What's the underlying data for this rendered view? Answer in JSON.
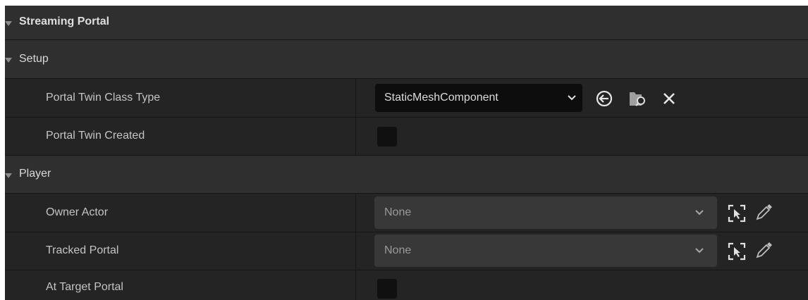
{
  "panel": {
    "title": "Streaming Portal"
  },
  "setup": {
    "label": "Setup",
    "properties": {
      "portal_twin_class_type": {
        "label": "Portal Twin Class Type",
        "value": "StaticMeshComponent"
      },
      "portal_twin_created": {
        "label": "Portal Twin Created",
        "checked": false
      }
    }
  },
  "player": {
    "label": "Player",
    "properties": {
      "owner_actor": {
        "label": "Owner Actor",
        "value": "None"
      },
      "tracked_portal": {
        "label": "Tracked Portal",
        "value": "None"
      },
      "at_target_portal": {
        "label": "At Target Portal",
        "checked": false
      }
    }
  },
  "icons": {
    "expand": "triangle-down-icon",
    "dropdown": "chevron-down-icon",
    "use_selected": "use-selected-arrow-icon",
    "browse": "browse-folder-icon",
    "clear": "close-icon",
    "select_actor": "select-actor-icon",
    "pick_actor": "eyedropper-icon"
  },
  "colors": {
    "panel_background": "#1a1a1a",
    "category_row": "#2f2f2f",
    "property_row": "#242424",
    "combo_dark": "#0d0d0d",
    "combo_light": "#383838",
    "text": "#c4c4c4"
  }
}
